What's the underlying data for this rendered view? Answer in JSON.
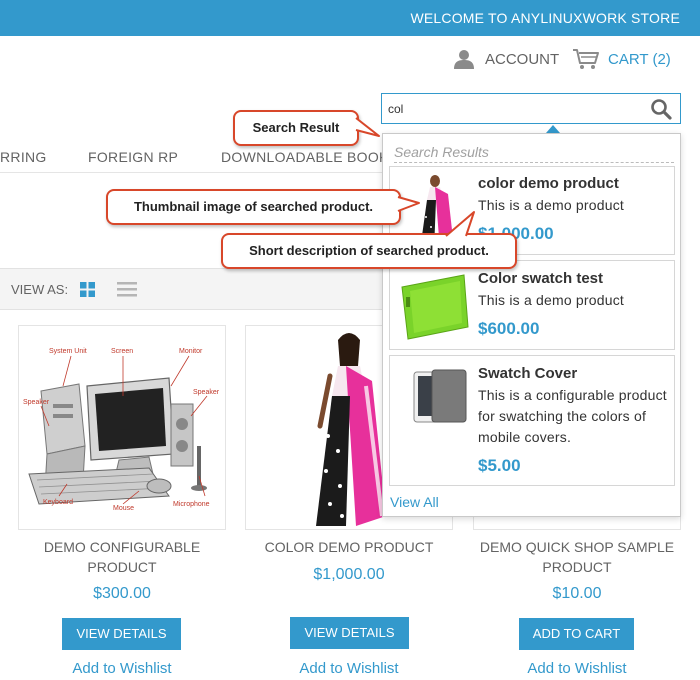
{
  "header": {
    "welcome": "WELCOME TO ANYLINUXWORK STORE",
    "account_label": "ACCOUNT",
    "cart_label": "CART (2)"
  },
  "search": {
    "value": "col",
    "placeholder": ""
  },
  "nav": {
    "items": [
      "RRING",
      "FOREIGN RP",
      "DOWNLOADABLE BOOK"
    ]
  },
  "toolbar": {
    "view_as_label": "VIEW AS:"
  },
  "products": [
    {
      "name": "DEMO CONFIGURABLE PRODUCT",
      "price": "$300.00",
      "button": "VIEW DETAILS",
      "wishlist": "Add to Wishlist"
    },
    {
      "name": "COLOR DEMO PRODUCT",
      "price": "$1,000.00",
      "button": "VIEW DETAILS",
      "wishlist": "Add to Wishlist"
    },
    {
      "name": "DEMO QUICK SHOP SAMPLE PRODUCT",
      "price": "$10.00",
      "button": "ADD TO CART",
      "wishlist": "Add to Wishlist"
    }
  ],
  "product_image_labels": {
    "computer": [
      "System Unit",
      "Screen",
      "Monitor",
      "Speaker",
      "Speaker",
      "Keyboard",
      "Mouse",
      "Microphone"
    ]
  },
  "dropdown": {
    "heading": "Search Results",
    "items": [
      {
        "title": "color demo product",
        "description": "This is a demo product",
        "price": "$1,000.00"
      },
      {
        "title": "Color swatch test",
        "description": "This is a demo product",
        "price": "$600.00"
      },
      {
        "title": "Swatch Cover",
        "description": "This is a configurable product for swatching the colors of mobile covers.",
        "price": "$5.00"
      }
    ],
    "view_all": "View All"
  },
  "callouts": {
    "search_result": "Search Result",
    "thumbnail": "Thumbnail image of searched product.",
    "short_description": "Short description of searched product."
  },
  "colors": {
    "accent": "#3399cc",
    "callout_border": "#d8472a",
    "text": "#636363"
  },
  "icons": [
    "user-icon",
    "cart-icon",
    "search-icon",
    "grid-view-icon",
    "list-view-icon"
  ]
}
